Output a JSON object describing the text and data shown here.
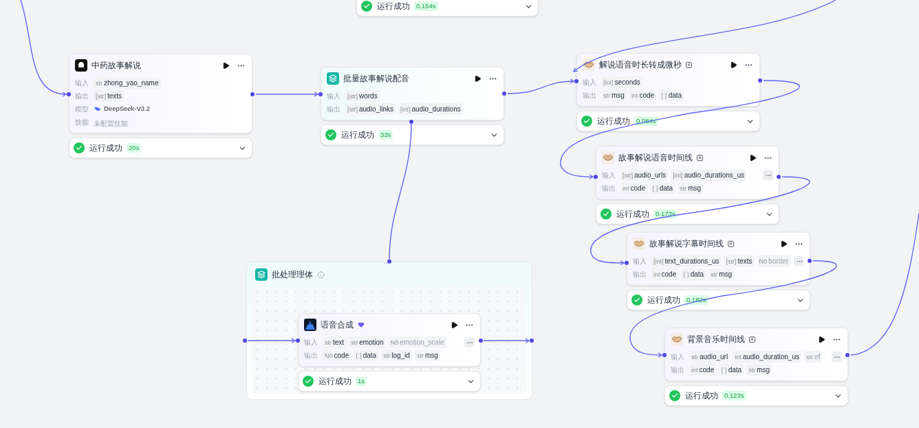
{
  "top_status": {
    "text": "运行成功",
    "time": "0.154s"
  },
  "nodes": [
    {
      "title": "中药故事解说",
      "kind": "llm",
      "rows": [
        {
          "kind": "params",
          "label": "输入",
          "params": [
            {
              "type": "str",
              "name": "zhong_yao_name",
              "faded": false
            }
          ]
        },
        {
          "kind": "params",
          "label": "输出",
          "params": [
            {
              "type": "[str]",
              "name": "texts",
              "faded": false
            }
          ]
        },
        {
          "kind": "model",
          "label": "模型",
          "value": "DeepSeek-V3.2"
        },
        {
          "kind": "text",
          "label": "技能",
          "value": "未配置技能"
        }
      ],
      "status": {
        "text": "运行成功",
        "time": "20s"
      }
    },
    {
      "title": "批量故事解说配音",
      "kind": "batch",
      "rows": [
        {
          "kind": "params",
          "label": "输入",
          "params": [
            {
              "type": "[str]",
              "name": "words",
              "faded": false
            }
          ]
        },
        {
          "kind": "params",
          "label": "输出",
          "params": [
            {
              "type": "[str]",
              "name": "audio_links",
              "faded": false
            },
            {
              "type": "[int]",
              "name": "audio_durations",
              "faded": false
            }
          ]
        }
      ],
      "status": {
        "text": "运行成功",
        "time": "33s"
      }
    },
    {
      "title": "解说语音时长转成微秒",
      "kind": "plugin",
      "rows": [
        {
          "kind": "params",
          "label": "输入",
          "params": [
            {
              "type": "[int]",
              "name": "seconds",
              "faded": false
            }
          ]
        },
        {
          "kind": "params",
          "label": "输出",
          "params": [
            {
              "type": "str",
              "name": "msg",
              "faded": false
            },
            {
              "type": "int",
              "name": "code",
              "faded": false
            },
            {
              "type": "{ }",
              "name": "data",
              "faded": false
            }
          ]
        }
      ],
      "status": {
        "text": "运行成功",
        "time": "0.084s"
      }
    },
    {
      "title": "故事解说语音时间线",
      "kind": "plugin",
      "rows": [
        {
          "kind": "params",
          "label": "输入",
          "more": true,
          "params": [
            {
              "type": "[str]",
              "name": "audio_urls",
              "faded": false
            },
            {
              "type": "[int]",
              "name": "audio_durations_us",
              "faded": false
            }
          ]
        },
        {
          "kind": "params",
          "label": "输出",
          "params": [
            {
              "type": "int",
              "name": "code",
              "faded": false
            },
            {
              "type": "{ }",
              "name": "data",
              "faded": false
            },
            {
              "type": "str",
              "name": "msg",
              "faded": false
            }
          ]
        }
      ],
      "status": {
        "text": "运行成功",
        "time": "0.173s"
      }
    },
    {
      "title": "故事解说字幕时间线",
      "kind": "plugin",
      "rows": [
        {
          "kind": "params",
          "label": "输入",
          "more": true,
          "params": [
            {
              "type": "[int]",
              "name": "text_durations_us",
              "faded": false
            },
            {
              "type": "[str]",
              "name": "texts",
              "faded": false
            },
            {
              "type": "N0",
              "name": "border",
              "faded": true
            }
          ]
        },
        {
          "kind": "params",
          "label": "输出",
          "params": [
            {
              "type": "int",
              "name": "code",
              "faded": false
            },
            {
              "type": "{ }",
              "name": "data",
              "faded": false
            },
            {
              "type": "str",
              "name": "msg",
              "faded": false
            }
          ]
        }
      ],
      "status": {
        "text": "运行成功",
        "time": "0.182s"
      }
    },
    {
      "title": "背景音乐时间线",
      "kind": "plugin",
      "rows": [
        {
          "kind": "params",
          "label": "输入",
          "more": true,
          "params": [
            {
              "type": "str",
              "name": "audio_url",
              "faded": false
            },
            {
              "type": "int",
              "name": "audio_duration_us",
              "faded": false
            },
            {
              "type": "str",
              "name": "ef",
              "faded": true
            }
          ]
        },
        {
          "kind": "params",
          "label": "输出",
          "params": [
            {
              "type": "int",
              "name": "code",
              "faded": false
            },
            {
              "type": "{ }",
              "name": "data",
              "faded": false
            },
            {
              "type": "str",
              "name": "msg",
              "faded": false
            }
          ]
        }
      ],
      "status": {
        "text": "运行成功",
        "time": "0.123s"
      }
    }
  ],
  "batch": {
    "title": "批处理理体",
    "node": {
      "title": "语音合成",
      "kind": "tts",
      "rows": [
        {
          "kind": "params",
          "label": "输入",
          "more": true,
          "params": [
            {
              "type": "str",
              "name": "text",
              "faded": false
            },
            {
              "type": "str",
              "name": "emotion",
              "faded": false
            },
            {
              "type": "N0",
              "name": "emotion_scale",
              "faded": true
            }
          ]
        },
        {
          "kind": "params",
          "label": "输出",
          "params": [
            {
              "type": "N0",
              "name": "code",
              "faded": false
            },
            {
              "type": "{ }",
              "name": "data",
              "faded": false
            },
            {
              "type": "str",
              "name": "log_id",
              "faded": false
            },
            {
              "type": "str",
              "name": "msg",
              "faded": false
            }
          ]
        }
      ],
      "status": {
        "text": "运行成功",
        "time": "1s"
      }
    }
  }
}
